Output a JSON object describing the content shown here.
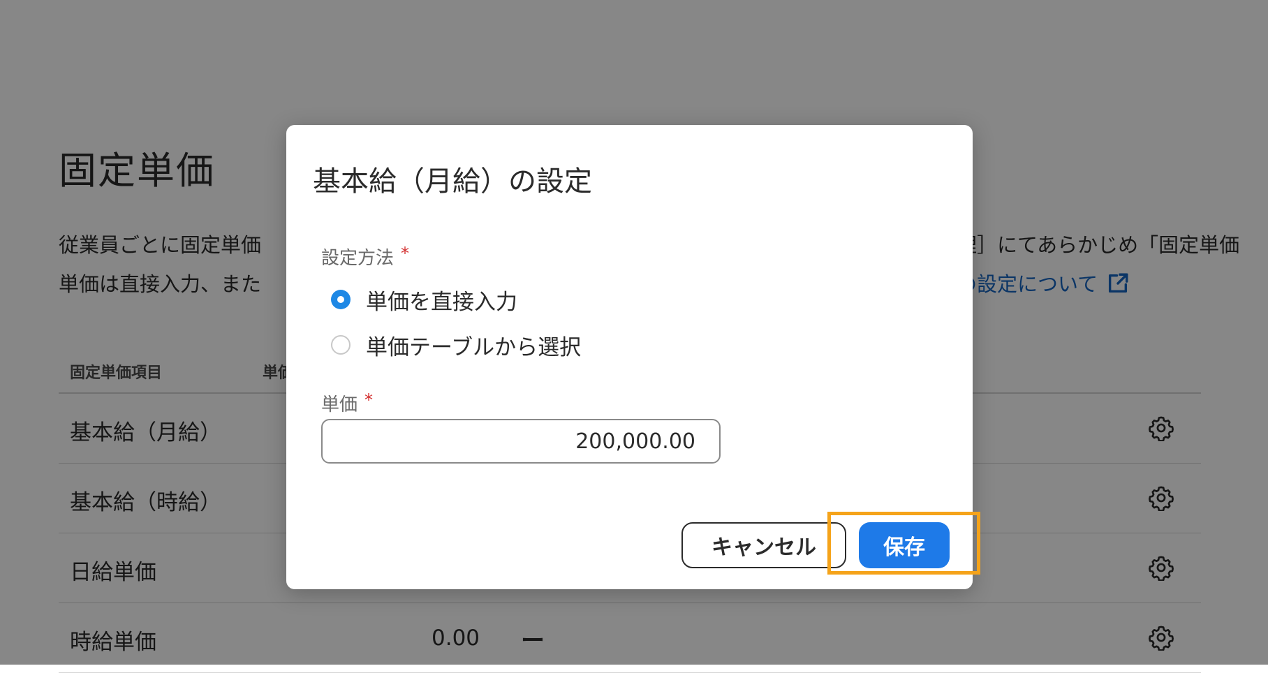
{
  "page": {
    "title": "固定単価",
    "description": {
      "line1_left": "従業員ごとに固定単価",
      "line1_right": "理］にてあらかじめ「固定単価",
      "line2_left": "単価は直接入力、また",
      "line2_right_link": "の設定について"
    },
    "table": {
      "headers": [
        "固定単価項目",
        "単価"
      ],
      "rows": [
        {
          "name": "基本給（月給）",
          "value": "",
          "dash": ""
        },
        {
          "name": "基本給（時給）",
          "value": "",
          "dash": ""
        },
        {
          "name": "日給単価",
          "value": "",
          "dash": ""
        },
        {
          "name": "時給単価",
          "value": "0.00",
          "dash": "ー"
        }
      ]
    }
  },
  "modal": {
    "title": "基本給（月給）の設定",
    "method_label": "設定方法",
    "required_mark": "*",
    "options": [
      {
        "label": "単価を直接入力",
        "selected": true
      },
      {
        "label": "単価テーブルから選択",
        "selected": false
      }
    ],
    "price_label": "単価",
    "price_value": "200,000.00",
    "cancel_label": "キャンセル",
    "save_label": "保存"
  },
  "icons": {
    "row_action": "gear-icon",
    "external_link": "external-link-icon"
  },
  "colors": {
    "accent": "#1e7ae8",
    "required": "#d32f2f",
    "highlight": "#f5a31a",
    "link": "#1565c0"
  }
}
